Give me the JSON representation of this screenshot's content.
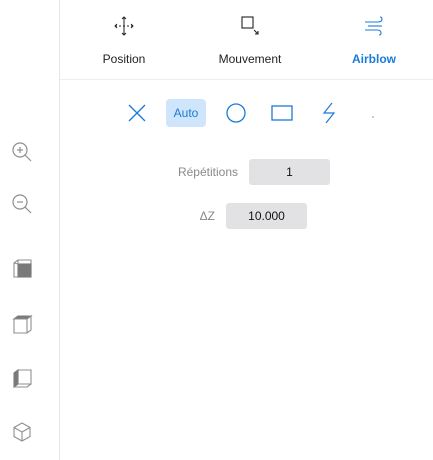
{
  "left_toolbar": {
    "tools": [
      {
        "name": "zoom-in-icon"
      },
      {
        "name": "zoom-out-icon"
      },
      {
        "name": "view-cube-front-icon"
      },
      {
        "name": "view-cube-top-icon"
      },
      {
        "name": "view-cube-side-icon"
      },
      {
        "name": "view-cube-iso-icon"
      }
    ]
  },
  "tabs": [
    {
      "label": "Position",
      "icon": "move-arrows-icon",
      "active": false
    },
    {
      "label": "Mouvement",
      "icon": "square-arrow-icon",
      "active": false
    },
    {
      "label": "Airblow",
      "icon": "wind-icon",
      "active": true
    }
  ],
  "airblow": {
    "modes": {
      "none_icon": "close-x-icon",
      "auto_label": "Auto",
      "circle_icon": "circle-icon",
      "rectangle_icon": "rectangle-icon",
      "zigzag_icon": "zigzag-icon"
    },
    "repetitions_label": "Répétitions",
    "repetitions_value": "1",
    "dz_label": "ΔZ",
    "dz_value": "10.000"
  },
  "colors": {
    "accent": "#1a7bd9",
    "accent_bg": "#cfe5fb",
    "icon_gray": "#8f8f8f",
    "field_bg": "#e2e2e5"
  }
}
